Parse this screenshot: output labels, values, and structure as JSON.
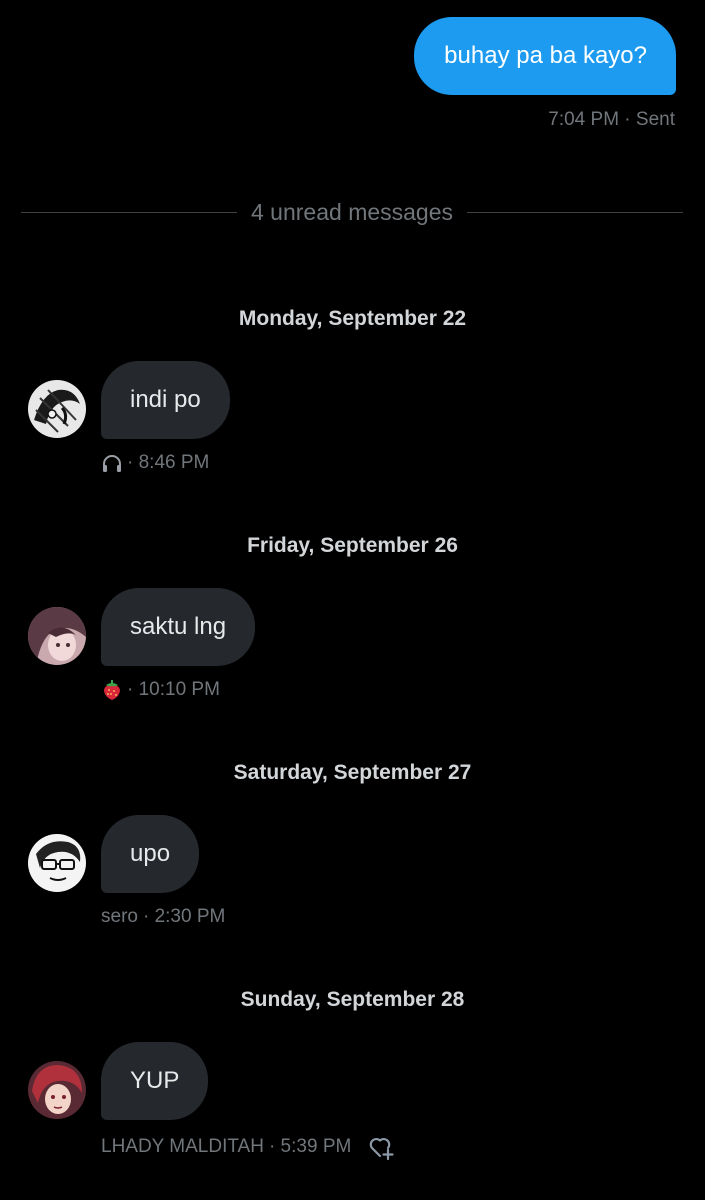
{
  "sent_message": {
    "text": "buhay pa ba kayo?",
    "meta": "7:04 PM · Sent"
  },
  "divider": {
    "label": "4 unread messages"
  },
  "threads": [
    {
      "date": "Monday, September 22",
      "message": "indi po",
      "sender": "",
      "sender_icon": "headphones-icon",
      "time": "· 8:46 PM"
    },
    {
      "date": "Friday, September 26",
      "message": "saktu lng",
      "sender": "",
      "sender_icon": "strawberry-emoji",
      "time": "· 10:10 PM"
    },
    {
      "date": "Saturday, September 27",
      "message": "upo",
      "sender": "sero",
      "time": "· 2:30 PM"
    },
    {
      "date": "Sunday, September 28",
      "message": "YUP",
      "sender": "LHADY MALDITAH",
      "time": "· 5:39 PM"
    }
  ],
  "colors": {
    "background": "#000000",
    "sent_bubble": "#1d9bf0",
    "received_bubble": "#25292e",
    "meta_text": "#71767b"
  }
}
